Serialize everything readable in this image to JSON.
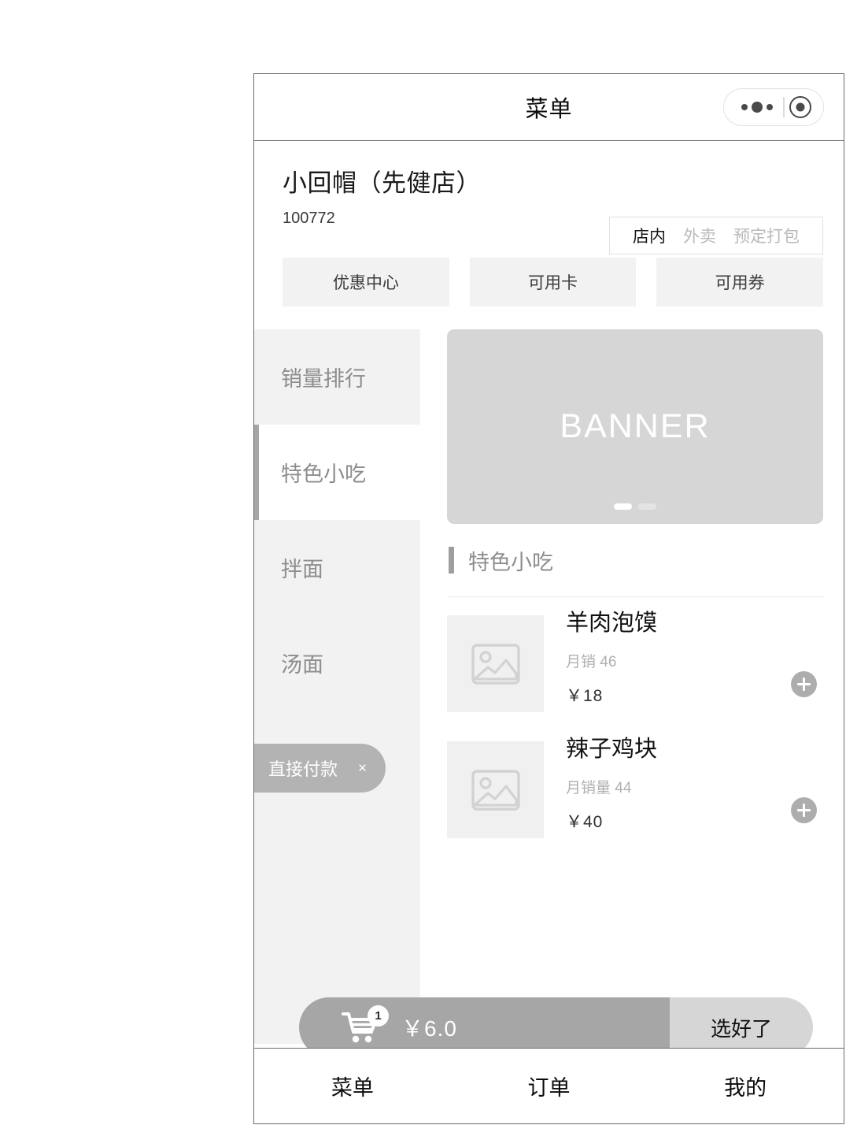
{
  "navbar": {
    "title": "菜单",
    "capsule": {
      "menu_icon": "more-dots-icon",
      "target_icon": "capsule-target-icon"
    }
  },
  "shop": {
    "name": "小回帽（先健店）",
    "code": "100772",
    "modes": [
      {
        "label": "店内",
        "active": true
      },
      {
        "label": "外卖",
        "active": false
      },
      {
        "label": "预定打包",
        "active": false
      }
    ]
  },
  "promos": [
    {
      "label": "优惠中心"
    },
    {
      "label": "可用卡"
    },
    {
      "label": "可用券"
    }
  ],
  "categories": [
    {
      "label": "销量排行",
      "active": false
    },
    {
      "label": "特色小吃",
      "active": true
    },
    {
      "label": "拌面",
      "active": false
    },
    {
      "label": "汤面",
      "active": false
    }
  ],
  "direct_pay": {
    "label": "直接付款",
    "close_label": "×"
  },
  "banner": {
    "text": "BANNER",
    "dots": 2,
    "active_dot": 0
  },
  "section": {
    "title": "特色小吃"
  },
  "products": [
    {
      "name": "羊肉泡馍",
      "sales": "月销 46",
      "price": "￥18",
      "add_label": "add-icon"
    },
    {
      "name": "辣子鸡块",
      "sales": "月销量 44",
      "price": "￥40",
      "add_label": "add-icon"
    }
  ],
  "cart": {
    "badge": "1",
    "total": "￥6.0",
    "checkout_label": "选好了"
  },
  "tabbar": [
    {
      "label": "菜单"
    },
    {
      "label": "订单"
    },
    {
      "label": "我的"
    }
  ],
  "colors": {
    "frame_border": "#6b6b6b",
    "sidebar_bg": "#f2f2f2",
    "active_bar": "#a6a6a6",
    "banner_bg": "#d6d6d6",
    "cart_left_bg": "#a6a6a6",
    "cart_right_bg": "#d6d6d6",
    "direct_pay_bg": "#b3b3b3",
    "add_button_bg": "#adadad",
    "muted_text": "#8d8d8d",
    "primary_text": "#111111"
  }
}
